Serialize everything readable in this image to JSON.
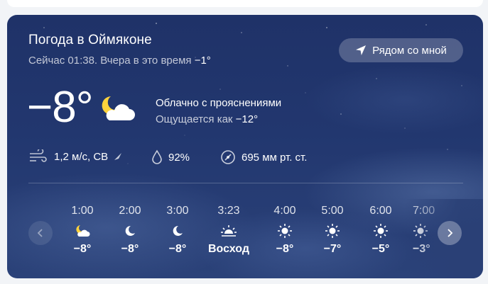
{
  "header": {
    "title": "Погода в Оймяконе",
    "now_label": "Сейчас 01:38. Вчера в это время",
    "yesterday_temp": "−1°",
    "nearby_button": "Рядом со мной"
  },
  "current": {
    "temperature": "−8°",
    "icon": "moon-cloud-icon",
    "condition": "Облачно с прояснениями",
    "feels_like_label": "Ощущается как",
    "feels_like_value": "−12°"
  },
  "metrics": {
    "wind": "1,2 м/с, СВ",
    "humidity": "92%",
    "pressure": "695 мм рт. ст."
  },
  "hourly": [
    {
      "time": "1:00",
      "icon": "moon-cloud-icon",
      "value": "−8°"
    },
    {
      "time": "2:00",
      "icon": "moon-icon",
      "value": "−8°"
    },
    {
      "time": "3:00",
      "icon": "moon-icon",
      "value": "−8°"
    },
    {
      "time": "3:23",
      "icon": "sunrise-icon",
      "value": "Восход"
    },
    {
      "time": "4:00",
      "icon": "sun-icon",
      "value": "−8°"
    },
    {
      "time": "5:00",
      "icon": "sun-icon",
      "value": "−7°"
    },
    {
      "time": "6:00",
      "icon": "sun-icon",
      "value": "−5°"
    },
    {
      "time": "7:00",
      "icon": "sun-icon",
      "value": "−3°"
    }
  ],
  "colors": {
    "card_background": "#22376f",
    "text": "#ffffff",
    "sun": "#ffd33c",
    "moon": "#ffd33c"
  }
}
